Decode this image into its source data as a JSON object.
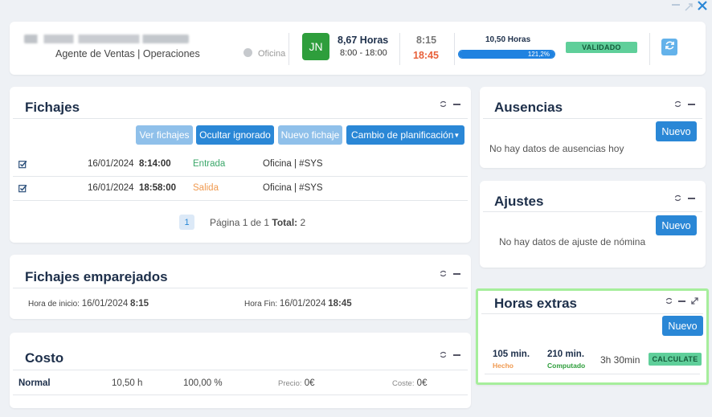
{
  "window": {
    "minimize_icon": "minimize-icon",
    "expand_icon": "expand-icon",
    "close_icon": "close-icon"
  },
  "header": {
    "employee_role": "Agente de Ventas | Operaciones",
    "location_label": "Oficina",
    "avatar_initials": "JN",
    "hours_total": "8,67 Horas",
    "schedule_range": "8:00 - 18:00",
    "clock_in": "8:15",
    "clock_out": "18:45",
    "worked_hours": "10,50 Horas",
    "progress_label": "121,2%",
    "progress_value": 1.212,
    "status_badge": "VALIDADO",
    "refresh_icon": "refresh-icon",
    "colors": {
      "avatar": "#2e9e3c",
      "clock_out": "#e8613a",
      "progress": "#1f82e0",
      "badge": "#5fcf9a"
    }
  },
  "fichajes": {
    "title": "Fichajes",
    "buttons": {
      "ver": "Ver fichajes",
      "ocultar": "Ocultar ignorado",
      "nuevo": "Nuevo fichaje",
      "cambio": "Cambio de planificación"
    },
    "rows": [
      {
        "date": "16/01/2024",
        "time": "8:14:00",
        "type": "Entrada",
        "source": "Oficina | #SYS"
      },
      {
        "date": "16/01/2024",
        "time": "18:58:00",
        "type": "Salida",
        "source": "Oficina | #SYS"
      }
    ],
    "pagination": {
      "current_page": "1",
      "summary_prefix": "Página 1 de 1",
      "total_label": "Total:",
      "total_value": "2"
    }
  },
  "emparejados": {
    "title": "Fichajes emparejados",
    "start_label": "Hora de inicio:",
    "start_date": "16/01/2024",
    "start_time": "8:15",
    "end_label": "Hora Fin:",
    "end_date": "16/01/2024",
    "end_time": "18:45"
  },
  "costo": {
    "title": "Costo",
    "row_label": "Normal",
    "hours": "10,50 h",
    "percent": "100,00 %",
    "price_label": "Precio:",
    "price_value": "0€",
    "cost_label": "Coste:",
    "cost_value": "0€"
  },
  "ausencias": {
    "title": "Ausencias",
    "new_button": "Nuevo",
    "empty_text": "No hay datos de ausencias hoy"
  },
  "ajustes": {
    "title": "Ajustes",
    "new_button": "Nuevo",
    "empty_text": "No hay datos de ajuste de nómina"
  },
  "horas_extras": {
    "title": "Horas extras",
    "new_button": "Nuevo",
    "done_value": "105 min.",
    "done_label": "Hecho",
    "computed_value": "210 min.",
    "computed_label": "Computado",
    "duration": "3h 30min",
    "calculate_button": "CALCULATE"
  }
}
